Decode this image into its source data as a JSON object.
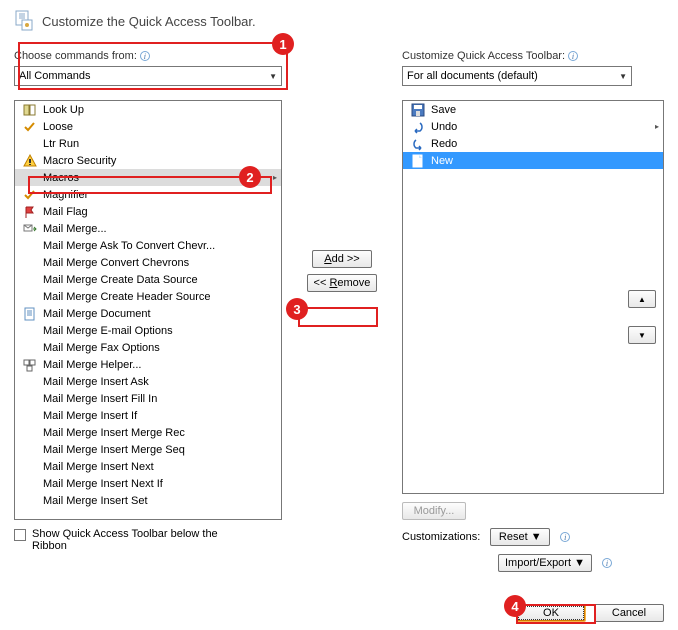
{
  "header": {
    "title": "Customize the Quick Access Toolbar."
  },
  "left": {
    "choose_label": "Choose commands from:",
    "combo_value": "All Commands",
    "items": [
      {
        "label": "Look Up",
        "icon": "book"
      },
      {
        "label": "Loose",
        "icon": "check-yellow"
      },
      {
        "label": "Ltr Run",
        "icon": "none"
      },
      {
        "label": "Macro Security",
        "icon": "warning"
      },
      {
        "label": "Macros",
        "icon": "none",
        "selected": true,
        "expand": true
      },
      {
        "label": "Magnifier",
        "icon": "check-yellow"
      },
      {
        "label": "Mail Flag",
        "icon": "flag"
      },
      {
        "label": "Mail Merge...",
        "icon": "mailmerge"
      },
      {
        "label": "Mail Merge Ask To Convert Chevr...",
        "icon": "none"
      },
      {
        "label": "Mail Merge Convert Chevrons",
        "icon": "none"
      },
      {
        "label": "Mail Merge Create Data Source",
        "icon": "none"
      },
      {
        "label": "Mail Merge Create Header Source",
        "icon": "none"
      },
      {
        "label": "Mail Merge Document",
        "icon": "doc"
      },
      {
        "label": "Mail Merge E-mail Options",
        "icon": "none"
      },
      {
        "label": "Mail Merge Fax Options",
        "icon": "none"
      },
      {
        "label": "Mail Merge Helper...",
        "icon": "helper"
      },
      {
        "label": "Mail Merge Insert Ask",
        "icon": "none"
      },
      {
        "label": "Mail Merge Insert Fill In",
        "icon": "none"
      },
      {
        "label": "Mail Merge Insert If",
        "icon": "none"
      },
      {
        "label": "Mail Merge Insert Merge Rec",
        "icon": "none"
      },
      {
        "label": "Mail Merge Insert Merge Seq",
        "icon": "none"
      },
      {
        "label": "Mail Merge Insert Next",
        "icon": "none"
      },
      {
        "label": "Mail Merge Insert Next If",
        "icon": "none"
      },
      {
        "label": "Mail Merge Insert Set",
        "icon": "none"
      }
    ],
    "show_below_label": "Show Quick Access Toolbar below the Ribbon"
  },
  "mid": {
    "add_label": "Add >>",
    "remove_label": "<< Remove"
  },
  "right": {
    "customize_label": "Customize Quick Access Toolbar:",
    "combo_value": "For all documents (default)",
    "items": [
      {
        "label": "Save",
        "icon": "save"
      },
      {
        "label": "Undo",
        "icon": "undo",
        "expand": true
      },
      {
        "label": "Redo",
        "icon": "redo"
      },
      {
        "label": "New",
        "icon": "new",
        "selected_blue": true
      }
    ],
    "modify_label": "Modify...",
    "customizations_label": "Customizations:",
    "reset_label": "Reset ▼",
    "import_export_label": "Import/Export ▼"
  },
  "arrows": {
    "up": "▲",
    "down": "▼"
  },
  "footer": {
    "ok_label": "OK",
    "cancel_label": "Cancel"
  },
  "callouts": {
    "n1": "1",
    "n2": "2",
    "n3": "3",
    "n4": "4"
  }
}
